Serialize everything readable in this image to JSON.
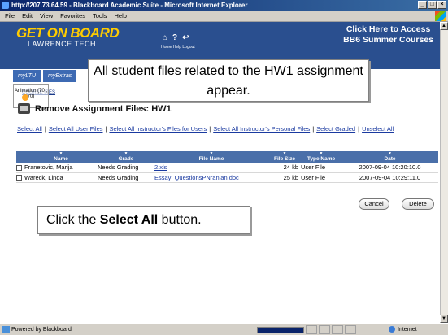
{
  "window": {
    "title": "http://207.73.64.59 - Blackboard Academic Suite - Microsoft Internet Explorer",
    "controls": [
      "_",
      "□",
      "×"
    ]
  },
  "menu": [
    "File",
    "Edit",
    "View",
    "Favorites",
    "Tools",
    "Help"
  ],
  "header": {
    "logo_line1": "GET ON BOARD",
    "logo_line2": "LAWRENCE TECH",
    "nav_labels": "Home  Help  Logout",
    "access_line1": "Click Here to Access",
    "access_line2": "BB6 Summer Courses"
  },
  "tabs": [
    "myLTU",
    "myExtras"
  ],
  "breadcrumb": "COURSE (TES",
  "annotation_tag": "Animation\n(70 , 70)",
  "page_title": "Remove Assignment Files: HW1",
  "callouts": {
    "top": "All student files related to the HW1 assignment appear.",
    "bottom_prefix": "Click the ",
    "bottom_bold": "Select All",
    "bottom_suffix": " button."
  },
  "links": [
    "Select All",
    "Select All User Files",
    "Select All Instructor's Files for Users",
    "Select All Instructor's Personal Files",
    "Select Graded",
    "Unselect All"
  ],
  "table": {
    "columns": [
      "Name",
      "Grade",
      "File Name",
      "File Size",
      "Type Name",
      "Date"
    ],
    "rows": [
      {
        "name": "Franetovic, Marija",
        "grade": "Needs Grading",
        "file": "2.xls",
        "size": "24 kb",
        "type": "User File",
        "date": "2007-09-04 10:20:10.0"
      },
      {
        "name": "Wareck, Linda",
        "grade": "Needs Grading",
        "file": "Essay_QuestionsPNranian.doc",
        "size": "25 kb",
        "type": "User File",
        "date": "2007-09-04 10:29:11.0"
      }
    ]
  },
  "buttons": {
    "cancel": "Cancel",
    "delete": "Delete"
  },
  "status": {
    "text": "Powered by Blackboard",
    "zone": "Internet",
    "progress": 1.0
  },
  "colors": {
    "header_bg": "#2a4f8f",
    "logo": "#ffcc00",
    "table_header": "#4a6fa9",
    "link": "#1a3aa0"
  }
}
